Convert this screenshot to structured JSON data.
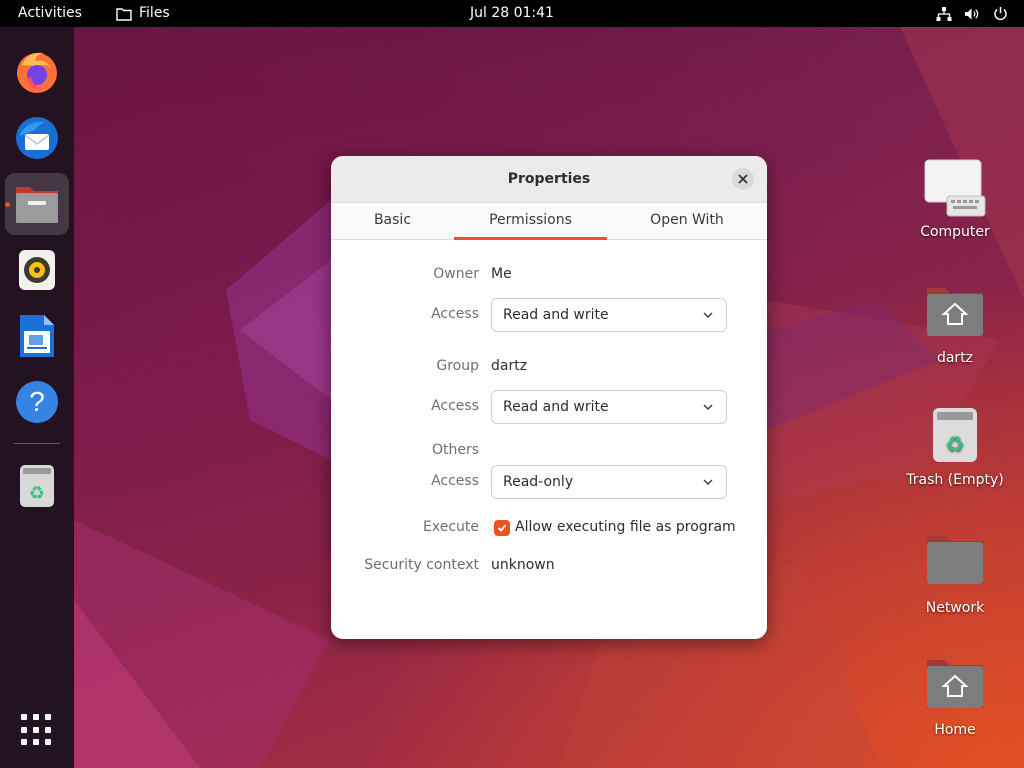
{
  "topbar": {
    "activities": "Activities",
    "app_name": "Files",
    "clock": "Jul 28  01:41",
    "tray_icons": [
      "network-icon",
      "volume-icon",
      "power-icon"
    ]
  },
  "dock": {
    "apps": [
      {
        "name": "firefox-icon",
        "running": false
      },
      {
        "name": "thunderbird-icon",
        "running": false
      },
      {
        "name": "files-icon",
        "running": true
      },
      {
        "name": "rhythmbox-icon",
        "running": false
      },
      {
        "name": "libreoffice-writer-icon",
        "running": false
      },
      {
        "name": "help-icon",
        "running": false
      },
      {
        "name": "trash-icon",
        "running": false
      }
    ],
    "show_apps_icon": "apps-grid-icon"
  },
  "desktop": {
    "icons": [
      {
        "label": "Computer",
        "icon": "computer-icon"
      },
      {
        "label": "dartz",
        "icon": "home-folder-icon"
      },
      {
        "label": "Trash (Empty)",
        "icon": "trash-icon"
      },
      {
        "label": "Network",
        "icon": "network-folder-icon"
      },
      {
        "label": "Home",
        "icon": "home-folder-icon"
      }
    ]
  },
  "dialog": {
    "title": "Properties",
    "tabs": [
      {
        "label": "Basic",
        "active": false
      },
      {
        "label": "Permissions",
        "active": true
      },
      {
        "label": "Open With",
        "active": false
      }
    ],
    "owner": {
      "label": "Owner",
      "value": "Me",
      "access_label": "Access",
      "access": "Read and write"
    },
    "group": {
      "label": "Group",
      "value": "dartz",
      "access_label": "Access",
      "access": "Read and write"
    },
    "others": {
      "label": "Others",
      "access_label": "Access",
      "access": "Read-only"
    },
    "execute": {
      "label": "Execute",
      "checkbox_label": "Allow executing file as program",
      "checked": true
    },
    "security": {
      "label": "Security context",
      "value": "unknown"
    }
  },
  "colors": {
    "accent": "#e95420",
    "topbar": "#000000",
    "dock": "#221222",
    "dialog_header": "#ebebeb"
  }
}
